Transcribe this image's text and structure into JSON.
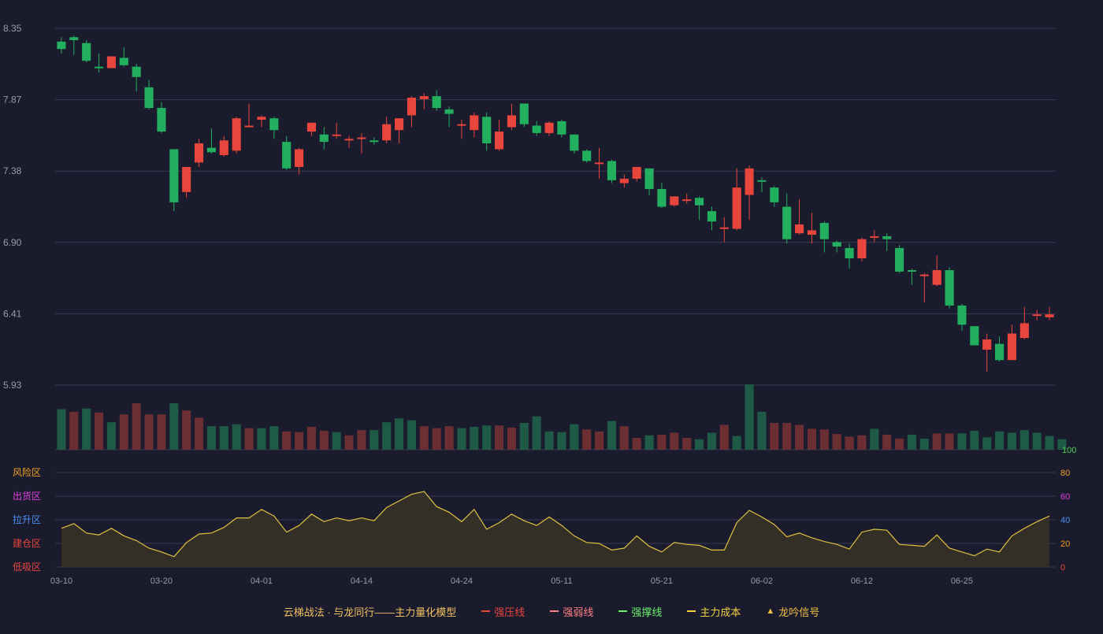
{
  "colors": {
    "background": "#1b1b2e",
    "grid": "#3a3a50",
    "axis_text": "#9a9aaa",
    "up": "#e8453c",
    "down": "#22b05e",
    "vol_up": "#6b2e33",
    "vol_down": "#1e5a45",
    "ind_line": "#e0c040",
    "ind_fill": "#3a3526"
  },
  "chart_data": [
    {
      "type": "candlestick",
      "y_ticks": [
        "8.35",
        "7.87",
        "7.38",
        "6.90",
        "6.41",
        "5.93"
      ],
      "ylim": [
        5.93,
        8.35
      ],
      "x_tick_labels": [
        {
          "index": 0,
          "label": "03-10"
        },
        {
          "index": 8,
          "label": "03-20"
        },
        {
          "index": 16,
          "label": "04-01"
        },
        {
          "index": 24,
          "label": "04-14"
        },
        {
          "index": 32,
          "label": "04-24"
        },
        {
          "index": 40,
          "label": "05-11"
        },
        {
          "index": 48,
          "label": "05-21"
        },
        {
          "index": 56,
          "label": "06-02"
        },
        {
          "index": 64,
          "label": "06-12"
        },
        {
          "index": 72,
          "label": "06-25"
        }
      ],
      "grid": true,
      "candles": [
        [
          8.26,
          8.21,
          8.29,
          8.18
        ],
        [
          8.29,
          8.27,
          8.3,
          8.17
        ],
        [
          8.25,
          8.13,
          8.27,
          8.12
        ],
        [
          8.09,
          8.08,
          8.18,
          8.05
        ],
        [
          8.08,
          8.16,
          8.16,
          8.08
        ],
        [
          8.15,
          8.1,
          8.22,
          8.09
        ],
        [
          8.09,
          8.02,
          8.11,
          7.92
        ],
        [
          7.95,
          7.81,
          8.0,
          7.8
        ],
        [
          7.81,
          7.65,
          7.85,
          7.64
        ],
        [
          7.53,
          7.17,
          7.53,
          7.11
        ],
        [
          7.24,
          7.41,
          7.41,
          7.2
        ],
        [
          7.44,
          7.57,
          7.6,
          7.41
        ],
        [
          7.54,
          7.51,
          7.67,
          7.5
        ],
        [
          7.49,
          7.59,
          7.62,
          7.48
        ],
        [
          7.52,
          7.74,
          7.75,
          7.5
        ],
        [
          7.69,
          7.69,
          7.84,
          7.68
        ],
        [
          7.73,
          7.75,
          7.76,
          7.68
        ],
        [
          7.74,
          7.66,
          7.75,
          7.6
        ],
        [
          7.58,
          7.4,
          7.62,
          7.39
        ],
        [
          7.41,
          7.53,
          7.54,
          7.36
        ],
        [
          7.65,
          7.71,
          7.71,
          7.62
        ],
        [
          7.63,
          7.58,
          7.68,
          7.53
        ],
        [
          7.62,
          7.63,
          7.71,
          7.6
        ],
        [
          7.59,
          7.6,
          7.62,
          7.54
        ],
        [
          7.6,
          7.61,
          7.64,
          7.5
        ],
        [
          7.59,
          7.58,
          7.61,
          7.56
        ],
        [
          7.59,
          7.7,
          7.75,
          7.57
        ],
        [
          7.66,
          7.74,
          7.74,
          7.57
        ],
        [
          7.76,
          7.88,
          7.89,
          7.68
        ],
        [
          7.87,
          7.89,
          7.91,
          7.8
        ],
        [
          7.89,
          7.81,
          7.93,
          7.79
        ],
        [
          7.8,
          7.77,
          7.82,
          7.68
        ],
        [
          7.7,
          7.7,
          7.73,
          7.6
        ],
        [
          7.66,
          7.76,
          7.78,
          7.61
        ],
        [
          7.75,
          7.57,
          7.78,
          7.52
        ],
        [
          7.53,
          7.65,
          7.73,
          7.52
        ],
        [
          7.68,
          7.76,
          7.84,
          7.66
        ],
        [
          7.84,
          7.7,
          7.84,
          7.68
        ],
        [
          7.69,
          7.64,
          7.72,
          7.62
        ],
        [
          7.64,
          7.71,
          7.72,
          7.62
        ],
        [
          7.72,
          7.63,
          7.73,
          7.61
        ],
        [
          7.63,
          7.52,
          7.63,
          7.5
        ],
        [
          7.52,
          7.45,
          7.53,
          7.44
        ],
        [
          7.44,
          7.44,
          7.54,
          7.33
        ],
        [
          7.45,
          7.32,
          7.46,
          7.3
        ],
        [
          7.3,
          7.33,
          7.36,
          7.27
        ],
        [
          7.33,
          7.41,
          7.41,
          7.31
        ],
        [
          7.4,
          7.26,
          7.4,
          7.22
        ],
        [
          7.26,
          7.14,
          7.3,
          7.13
        ],
        [
          7.15,
          7.21,
          7.21,
          7.14
        ],
        [
          7.19,
          7.19,
          7.23,
          7.16
        ],
        [
          7.2,
          7.15,
          7.21,
          7.05
        ],
        [
          7.11,
          7.04,
          7.14,
          6.98
        ],
        [
          7.0,
          7.0,
          7.07,
          6.9
        ],
        [
          6.99,
          7.27,
          7.4,
          6.98
        ],
        [
          7.22,
          7.4,
          7.42,
          7.05
        ],
        [
          7.32,
          7.31,
          7.34,
          7.24
        ],
        [
          7.27,
          7.17,
          7.28,
          7.14
        ],
        [
          7.14,
          6.92,
          7.23,
          6.89
        ],
        [
          6.96,
          7.02,
          7.19,
          6.95
        ],
        [
          6.95,
          6.98,
          7.1,
          6.89
        ],
        [
          7.03,
          6.92,
          7.04,
          6.83
        ],
        [
          6.9,
          6.87,
          6.91,
          6.83
        ],
        [
          6.86,
          6.79,
          6.89,
          6.72
        ],
        [
          6.79,
          6.92,
          6.93,
          6.77
        ],
        [
          6.93,
          6.94,
          6.98,
          6.9
        ],
        [
          6.94,
          6.92,
          6.96,
          6.84
        ],
        [
          6.86,
          6.7,
          6.88,
          6.69
        ],
        [
          6.71,
          6.7,
          6.72,
          6.61
        ],
        [
          6.68,
          6.68,
          6.69,
          6.49
        ],
        [
          6.61,
          6.71,
          6.81,
          6.6
        ],
        [
          6.71,
          6.47,
          6.73,
          6.45
        ],
        [
          6.47,
          6.34,
          6.48,
          6.3
        ],
        [
          6.33,
          6.2,
          6.33,
          6.2
        ],
        [
          6.17,
          6.24,
          6.28,
          6.02
        ],
        [
          6.21,
          6.1,
          6.26,
          6.09
        ],
        [
          6.1,
          6.28,
          6.34,
          6.1
        ],
        [
          6.25,
          6.35,
          6.46,
          6.24
        ],
        [
          6.4,
          6.41,
          6.44,
          6.37
        ],
        [
          6.39,
          6.41,
          6.46,
          6.37
        ]
      ]
    },
    {
      "type": "bar",
      "name": "volume",
      "ymax_label": "100",
      "values": [
        62,
        58,
        63,
        57,
        42,
        54,
        71,
        54,
        54,
        71,
        60,
        49,
        36,
        36,
        39,
        33,
        33,
        36,
        28,
        27,
        35,
        29,
        27,
        22,
        30,
        30,
        42,
        48,
        45,
        36,
        33,
        36,
        33,
        35,
        37,
        37,
        34,
        41,
        51,
        28,
        27,
        39,
        31,
        28,
        44,
        36,
        18,
        22,
        23,
        26,
        18,
        16,
        26,
        38,
        21,
        100,
        58,
        41,
        41,
        38,
        32,
        31,
        24,
        20,
        22,
        32,
        23,
        17,
        23,
        17,
        25,
        25,
        25,
        29,
        19,
        28,
        26,
        30,
        26,
        21,
        16
      ],
      "up": [
        0,
        1,
        0,
        1,
        0,
        1,
        1,
        1,
        1,
        0,
        1,
        1,
        0,
        0,
        0,
        1,
        0,
        0,
        1,
        1,
        1,
        1,
        0,
        1,
        1,
        0,
        0,
        0,
        0,
        1,
        1,
        1,
        0,
        0,
        0,
        1,
        1,
        0,
        0,
        0,
        0,
        0,
        1,
        1,
        0,
        1,
        1,
        0,
        1,
        1,
        1,
        0,
        0,
        1,
        0,
        0,
        0,
        1,
        1,
        1,
        1,
        1,
        1,
        1,
        1,
        0,
        1,
        1,
        0,
        0,
        1,
        1,
        0,
        0,
        0,
        0,
        0,
        0,
        0,
        0,
        0
      ]
    },
    {
      "type": "area",
      "name": "indicator",
      "ylim": [
        0,
        100
      ],
      "right_ticks": [
        "100",
        "80",
        "60",
        "40",
        "20",
        "0"
      ],
      "zone_labels": [
        "风险区",
        "出货区",
        "拉升区",
        "建仓区",
        "低吸区"
      ],
      "values": [
        41,
        46,
        36,
        34,
        41,
        33,
        28,
        20,
        16,
        11,
        26,
        35,
        36,
        42,
        52,
        52,
        61,
        54,
        37,
        44,
        56,
        48,
        52,
        49,
        52,
        49,
        63,
        70,
        77,
        80,
        64,
        58,
        48,
        61,
        40,
        47,
        56,
        49,
        44,
        53,
        44,
        33,
        26,
        25,
        18,
        20,
        33,
        22,
        16,
        26,
        24,
        23,
        18,
        18,
        47,
        60,
        53,
        45,
        32,
        36,
        31,
        27,
        24,
        19,
        37,
        40,
        39,
        24,
        23,
        22,
        34,
        20,
        16,
        12,
        19,
        16,
        33,
        41,
        48,
        54
      ]
    }
  ],
  "legend": {
    "title": "云梯战法 · 与龙同行——主力量化模型",
    "items": [
      {
        "label": "强压线",
        "color": "#e8453c",
        "style": "solid"
      },
      {
        "label": "强弱线",
        "color": "#ff8080",
        "style": "dashed"
      },
      {
        "label": "强撑线",
        "color": "#6cf06c",
        "style": "solid"
      },
      {
        "label": "主力成本",
        "color": "#f0d040",
        "style": "dashed"
      },
      {
        "label": "龙吟信号",
        "color": "#f0c040",
        "style": "triangle"
      }
    ]
  }
}
